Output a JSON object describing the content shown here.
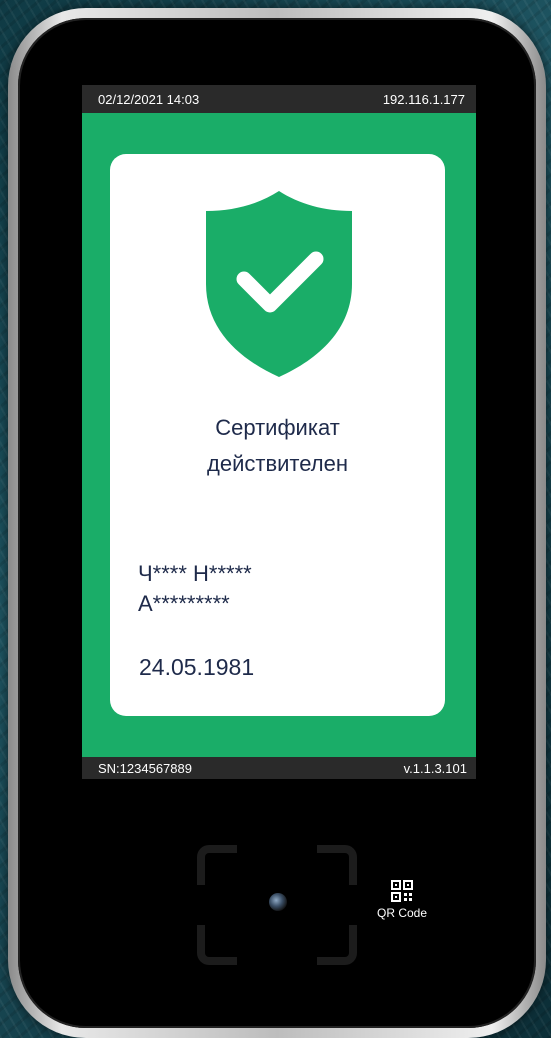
{
  "screen": {
    "status_bar": {
      "datetime": "02/12/2021 14:03",
      "ip": "192.116.1.177"
    },
    "card": {
      "status_line1": "Сертификат",
      "status_line2": "действителен",
      "holder_name_line1": "Ч**** Н*****",
      "holder_name_line2": "А*********",
      "date_of_birth": "24.05.1981"
    },
    "bottom_bar": {
      "serial": "SN:1234567889",
      "version": "v.1.1.3.101"
    }
  },
  "scanner": {
    "qr_label": "QR Code"
  },
  "colors": {
    "screen_green": "#1aad68",
    "shield_green": "#1aad68",
    "text_navy": "#1e2a4a",
    "bar_dark": "#2a2a2a"
  },
  "icons": {
    "status": "shield-check-icon",
    "scanner": "qr-code-icon",
    "camera": "camera-lens-icon"
  }
}
